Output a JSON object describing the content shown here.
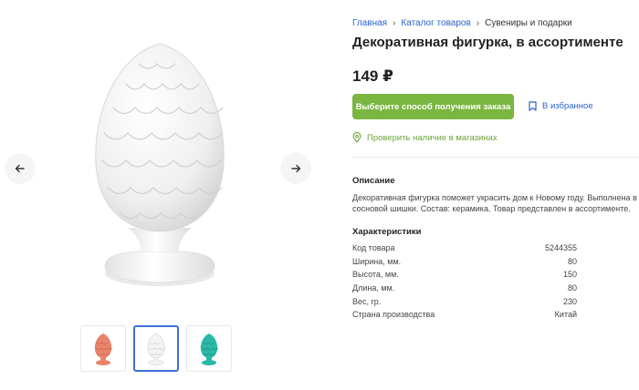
{
  "gallery": {
    "main_image_alt": "Декоративная фигурка — белая шишка",
    "prev_icon": "arrow-left-icon",
    "next_icon": "arrow-right-icon",
    "thumbnails": [
      {
        "color": "#e9846b",
        "active": false
      },
      {
        "color": "#f4f4f4",
        "active": true
      },
      {
        "color": "#2bb8a8",
        "active": false
      }
    ]
  },
  "breadcrumb": {
    "items": [
      "Главная",
      "Каталог товаров",
      "Сувениры и подарки"
    ]
  },
  "product": {
    "title": "Декоративная фигурка, в ассортименте",
    "price": "149 ₽"
  },
  "actions": {
    "order_label": "Выберите способ получения заказа",
    "favorite_label": "В избранное",
    "stock_label": "Проверить наличие в магазинах"
  },
  "description": {
    "heading": "Описание",
    "text": "Декоративная фигурка поможет украсить дом к Новому году. Выполнена в в сосновой шишки. Состав: керамика. Товар представлен в ассортименте."
  },
  "specs": {
    "heading": "Характеристики",
    "rows": [
      {
        "label": "Код товара",
        "value": "5244355"
      },
      {
        "label": "Ширина, мм.",
        "value": "80"
      },
      {
        "label": "Высота, мм.",
        "value": "150"
      },
      {
        "label": "Длина, мм.",
        "value": "80"
      },
      {
        "label": "Вес, гр.",
        "value": "230"
      },
      {
        "label": "Страна производства",
        "value": "Китай"
      }
    ]
  },
  "colors": {
    "accent_green": "#7ab640",
    "link_blue": "#2a63c9",
    "stock_green": "#6da33a"
  }
}
